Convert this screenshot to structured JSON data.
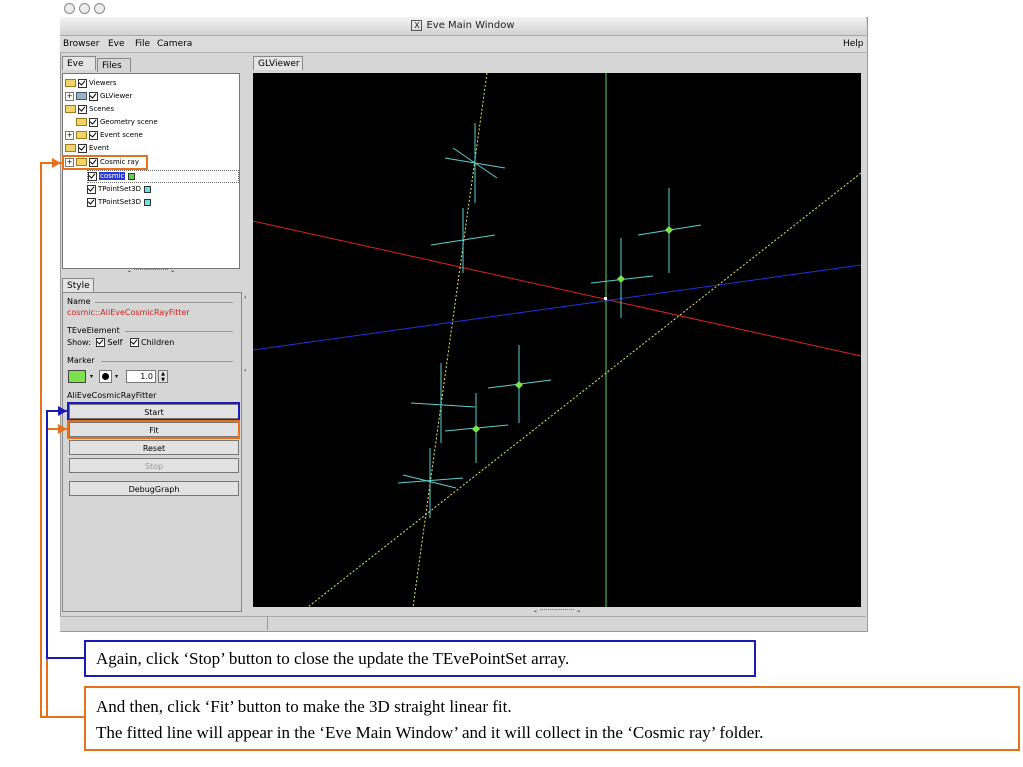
{
  "window": {
    "title": "Eve Main Window"
  },
  "menubar": {
    "items": [
      "Browser",
      "Eve",
      "File",
      "Camera"
    ],
    "help": "Help"
  },
  "left_tabs": [
    "Eve",
    "Files"
  ],
  "tree": {
    "items": [
      {
        "label": "Viewers"
      },
      {
        "label": "GLViewer"
      },
      {
        "label": "Scenes"
      },
      {
        "label": "Geometry scene"
      },
      {
        "label": "Event scene"
      },
      {
        "label": "Event"
      },
      {
        "label": "Cosmic ray"
      },
      {
        "label": "cosmic"
      },
      {
        "label": "TPointSet3D"
      },
      {
        "label": "TPointSet3D"
      }
    ]
  },
  "style_panel": {
    "tab": "Style",
    "name_header": "Name",
    "name_value": "cosmic::AliEveCosmicRayFitter",
    "element_header": "TEveElement",
    "show_label": "Show:",
    "self_label": "Self",
    "children_label": "Children",
    "marker_header": "Marker",
    "marker_size": "1.0",
    "fitter_header": "AliEveCosmicRayFitter",
    "buttons": {
      "start": "Start",
      "fit": "Fit",
      "reset": "Reset",
      "stop": "Stop",
      "debug": "DebugGraph"
    }
  },
  "viewer_tab": "GLViewer",
  "callouts": {
    "stop_text": "Again, click ‘Stop’ button to close the update the TEvePointSet array.",
    "fit_line1": "And then, click ‘Fit’ button to make the 3D straight linear fit.",
    "fit_line2": "The fitted line will appear in the ‘Eve Main Window’ and it will collect in the ‘Cosmic ray’ folder."
  },
  "colors": {
    "blue_callout": "#1a1ab4",
    "orange_callout": "#e8701a",
    "selected_name": "#d42020",
    "marker_color": "#7de14a"
  }
}
